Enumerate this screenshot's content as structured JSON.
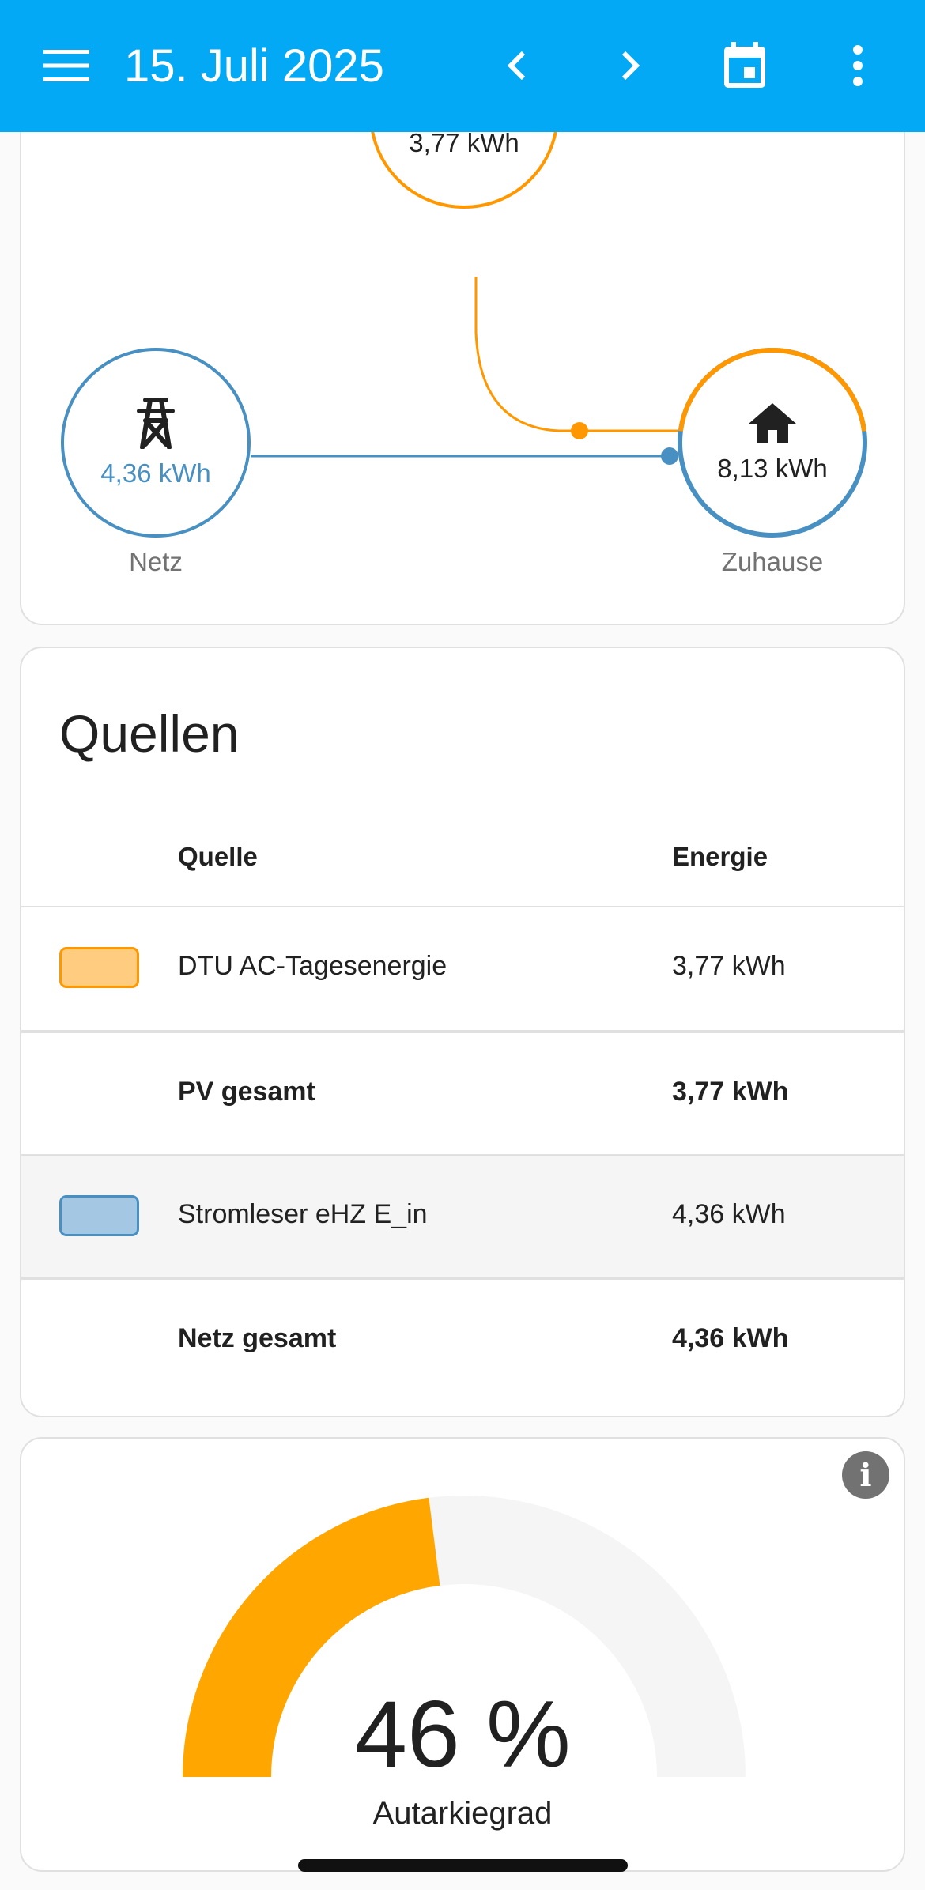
{
  "appbar": {
    "date_title": "15. Juli 2025",
    "icons": [
      "menu-icon",
      "chevron-left-icon",
      "chevron-right-icon",
      "calendar-icon",
      "more-vertical-icon"
    ]
  },
  "energy_flow": {
    "solar": {
      "value": "3,77 kWh",
      "icon": "solar-power-icon",
      "color": "#ff9800"
    },
    "grid": {
      "value": "4,36 kWh",
      "label": "Netz",
      "icon": "transmission-tower-icon",
      "color": "#488fc2"
    },
    "home": {
      "value": "8,13 kWh",
      "label": "Zuhause",
      "icon": "home-icon",
      "solar_share": 0.46
    }
  },
  "sources": {
    "title": "Quellen",
    "headers": {
      "source": "Quelle",
      "energy": "Energie"
    },
    "rows": [
      {
        "name": "DTU AC-Tagesenergie",
        "energy": "3,77 kWh",
        "swatch_fill": "#ffcc80",
        "swatch_border": "#ff9800"
      },
      {
        "name": "PV gesamt",
        "energy": "3,77 kWh"
      },
      {
        "name": "Stromleser eHZ E_in",
        "energy": "4,36 kWh",
        "swatch_fill": "#a4c7e4",
        "swatch_border": "#488fc2"
      },
      {
        "name": "Netz gesamt",
        "energy": "4,36 kWh"
      }
    ]
  },
  "gauge": {
    "value": 46,
    "value_text": "46 %",
    "label": "Autarkiegrad",
    "fill_color": "#ffa600",
    "track_color": "#f5f5f5"
  }
}
